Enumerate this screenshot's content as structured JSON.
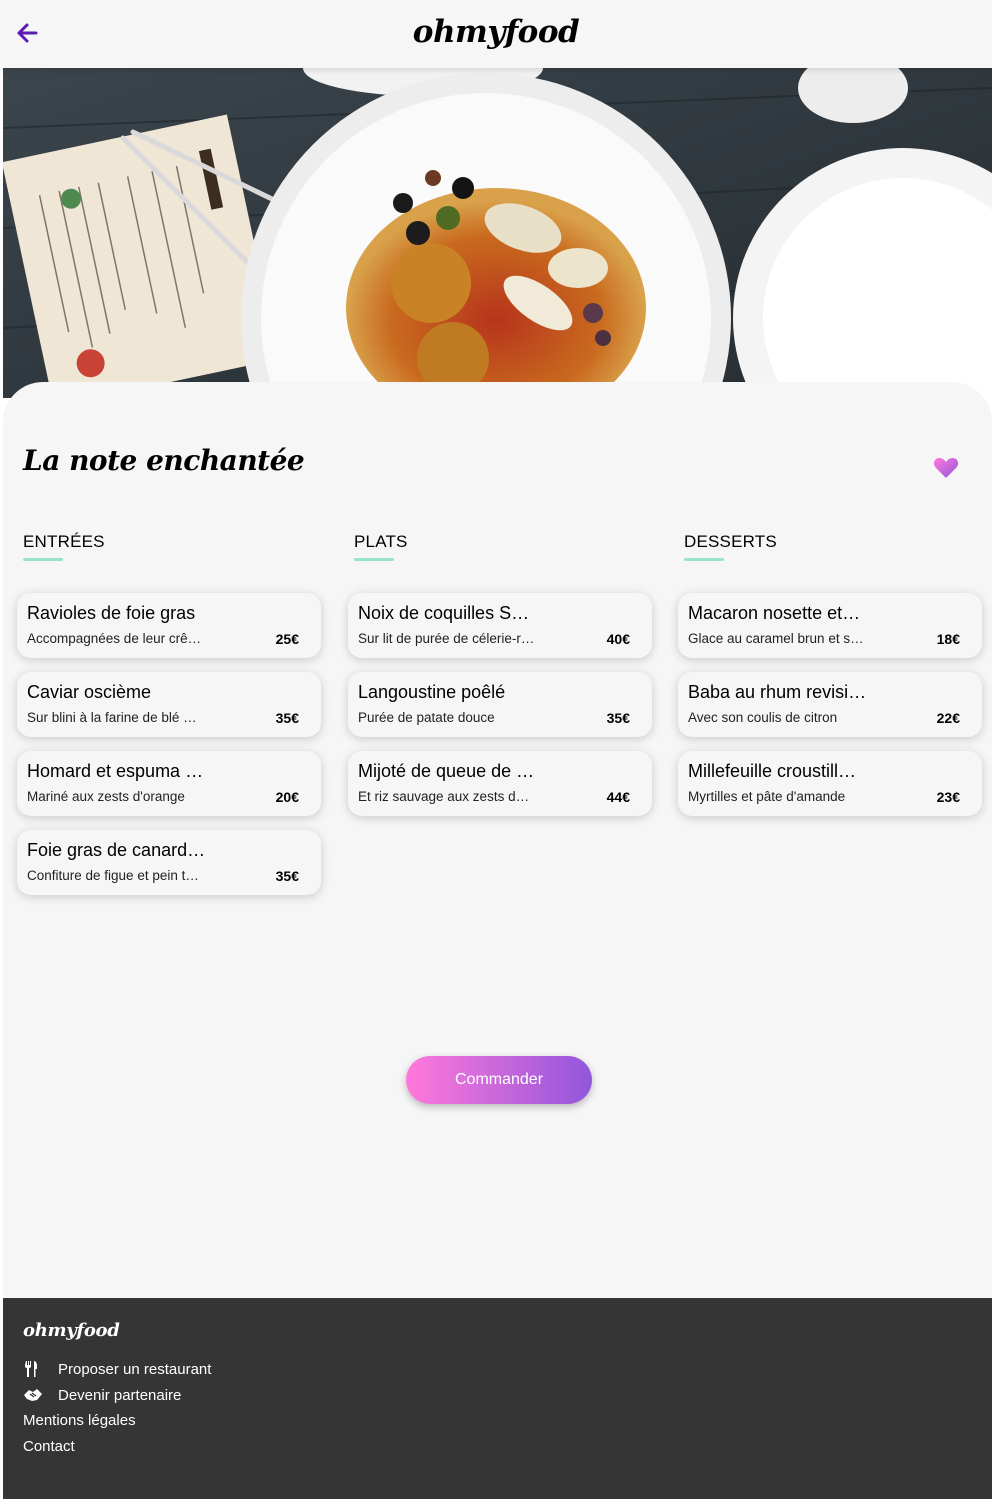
{
  "header": {
    "logo": "ohmyfood",
    "back_icon": "arrow-left-icon"
  },
  "hero": {
    "image_desc_icon": "hero-food-photo"
  },
  "restaurant": {
    "name": "La note enchantée",
    "like_icon": "heart-icon"
  },
  "menu": {
    "starters": {
      "title": "ENTRÉES",
      "items": [
        {
          "name": "Ravioles de foie gras",
          "desc": "Accompagnées de leur crê…",
          "price": "25€"
        },
        {
          "name": "Caviar oscième",
          "desc": "Sur blini à la farine de blé …",
          "price": "35€"
        },
        {
          "name": "Homard et espuma …",
          "desc": "Mariné aux zests d'orange",
          "price": "20€"
        },
        {
          "name": "Foie gras de canard…",
          "desc": "Confiture de figue et pein t…",
          "price": "35€"
        }
      ]
    },
    "mains": {
      "title": "PLATS",
      "items": [
        {
          "name": "Noix de coquilles S…",
          "desc": "Sur lit de purée de célerie-r…",
          "price": "40€"
        },
        {
          "name": "Langoustine poêlé",
          "desc": "Purée de patate douce",
          "price": "35€"
        },
        {
          "name": "Mijoté de queue de …",
          "desc": "Et riz sauvage aux zests d…",
          "price": "44€"
        }
      ]
    },
    "desserts": {
      "title": "DESSERTS",
      "items": [
        {
          "name": "Macaron nosette et…",
          "desc": "Glace au caramel brun et s…",
          "price": "18€"
        },
        {
          "name": "Baba au rhum revisi…",
          "desc": "Avec son coulis de citron",
          "price": "22€"
        },
        {
          "name": "Millefeuille croustill…",
          "desc": "Myrtilles et pâte d'amande",
          "price": "23€"
        }
      ]
    }
  },
  "order_button": {
    "label": "Commander"
  },
  "footer": {
    "logo": "ohmyfood",
    "links": [
      {
        "label": "Proposer un restaurant",
        "icon": "utensils-icon"
      },
      {
        "label": "Devenir partenaire",
        "icon": "handshake-icon"
      },
      {
        "label": "Mentions légales"
      },
      {
        "label": "Contact"
      }
    ]
  },
  "colors": {
    "accent_purple": "#9356dc",
    "accent_pink": "#ff79da",
    "underline_teal": "#99e2d0",
    "footer_bg": "#353535",
    "page_bg": "#f6f6f6"
  }
}
